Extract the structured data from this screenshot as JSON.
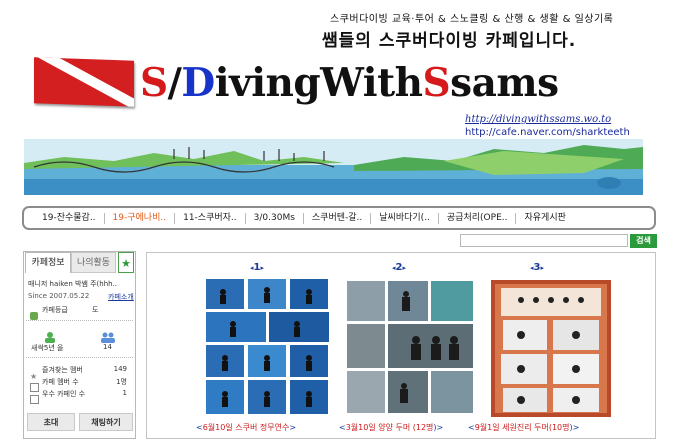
{
  "header": {
    "tagline": "스쿠버다이빙 교육·투어 & 스노클링 & 산행 & 생활 & 일상기록",
    "subtitle": "쌤들의 스쿠버다이빙 카페입니다.",
    "logo": {
      "p1": "S",
      "p2": "/",
      "p3": "D",
      "p4": "iving",
      "p5": "W",
      "p6": "ith",
      "p7": "S",
      "p8": "sams"
    },
    "url_italic": "http://divingwithssams.wo.to",
    "url_cafe": "http://cafe.naver.com/sharkteeth"
  },
  "menu": {
    "items": [
      "19-잔수물감..",
      "19-구에나비..",
      "11-스쿠버자..",
      "3/0.30Ms",
      "스쿠버텐-갈..",
      "날씨바다기(..",
      "공급처리(OPE..",
      "자유게시판"
    ],
    "active_index": 1
  },
  "search": {
    "placeholder": "",
    "button_label": "검색"
  },
  "sidebar": {
    "tabs": [
      "카페정보",
      "나의활동"
    ],
    "star": "★",
    "manager_line": "매니저 haiken 박쌤 주(hhh..",
    "since_line": "Since 2007.05.22",
    "invite_link": "카페소개",
    "grade_label": "카페등급",
    "grade_value": "도",
    "member_label": "새싹5년 을",
    "member_value": "14",
    "rows": [
      {
        "label": "즐겨찾는 멤버",
        "count": "149"
      },
      {
        "label": "카페 멤버 수",
        "count": "1명"
      },
      {
        "label": "우수 카페인 수",
        "count": "1"
      }
    ],
    "btn_invite": "초대",
    "btn_chat": "채팅하기"
  },
  "main": {
    "ranks": [
      "1",
      "2",
      "3"
    ],
    "captions": [
      {
        "pre": "<",
        "red": "6월10일 스쿠버 정무연수",
        "post": ">"
      },
      {
        "pre": "<",
        "red": "3월10일 양양 두머 (12명",
        "post": ")>"
      },
      {
        "pre": "<",
        "red": "9월1일 세원진리 두머(10명",
        "post": ")>"
      }
    ]
  },
  "colors": {
    "accent_green": "#2a9a3a",
    "link_blue": "#1a3a9a",
    "brand_red": "#d41a1a",
    "brand_blue": "#1733c9"
  }
}
